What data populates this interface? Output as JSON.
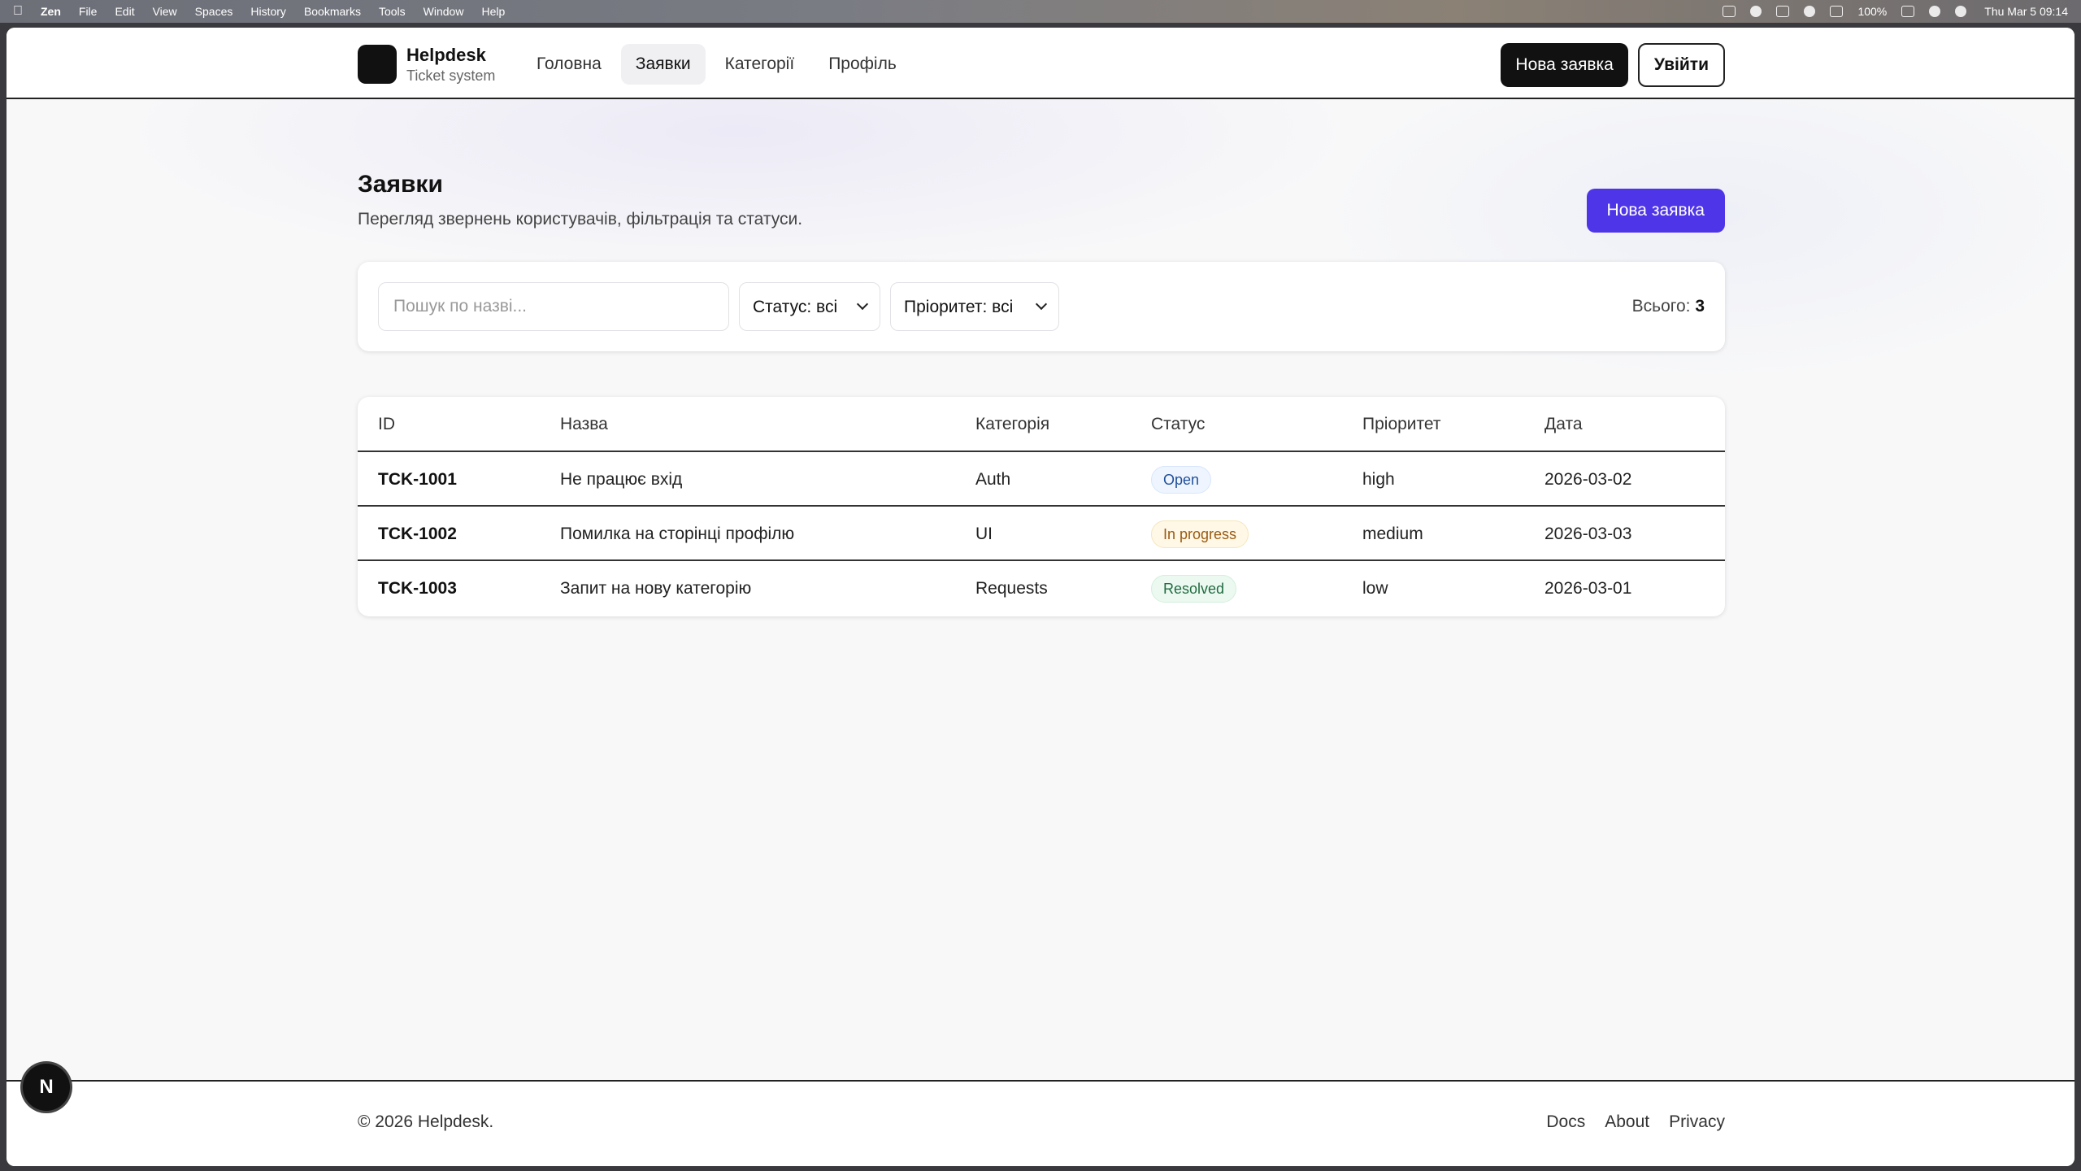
{
  "menubar": {
    "app": "Zen",
    "items": [
      "File",
      "Edit",
      "View",
      "Spaces",
      "History",
      "Bookmarks",
      "Tools",
      "Window",
      "Help"
    ],
    "battery": "100%",
    "datetime": "Thu Mar 5  09:14"
  },
  "header": {
    "brand_title": "Helpdesk",
    "brand_sub": "Ticket system",
    "nav": [
      {
        "label": "Головна"
      },
      {
        "label": "Заявки"
      },
      {
        "label": "Категорії"
      },
      {
        "label": "Профіль"
      }
    ],
    "new_ticket_label": "Нова заявка",
    "logout_label": "Увійти"
  },
  "page": {
    "title": "Заявки",
    "subtitle": "Перегляд звернень користувачів, фільтрація та статуси.",
    "new_ticket_label": "Нова заявка"
  },
  "filters": {
    "search_placeholder": "Пошук по назві...",
    "status_value": "Статус: всі",
    "priority_value": "Пріоритет: всі",
    "total_label": "Всього:",
    "total_count": "3"
  },
  "table": {
    "headers": [
      "ID",
      "Назва",
      "Категорія",
      "Статус",
      "Пріоритет",
      "Дата"
    ],
    "rows": [
      {
        "id": "TCK-1001",
        "title": "Не працює вхід",
        "category": "Auth",
        "status": "Open",
        "priority": "high",
        "date": "2026-03-02"
      },
      {
        "id": "TCK-1002",
        "title": "Помилка на сторінці профілю",
        "category": "UI",
        "status": "In progress",
        "priority": "medium",
        "date": "2026-03-03"
      },
      {
        "id": "TCK-1003",
        "title": "Запит на нову категорію",
        "category": "Requests",
        "status": "Resolved",
        "priority": "low",
        "date": "2026-03-01"
      }
    ]
  },
  "footer": {
    "copyright": "© 2026 Helpdesk.",
    "links": [
      "Docs",
      "About",
      "Privacy"
    ]
  },
  "colors": {
    "primary": "#4f35e8",
    "dark": "#111111",
    "status_open": "#1f4f9a",
    "status_progress": "#9a5a12",
    "status_resolved": "#226b40"
  },
  "next_badge": "N"
}
